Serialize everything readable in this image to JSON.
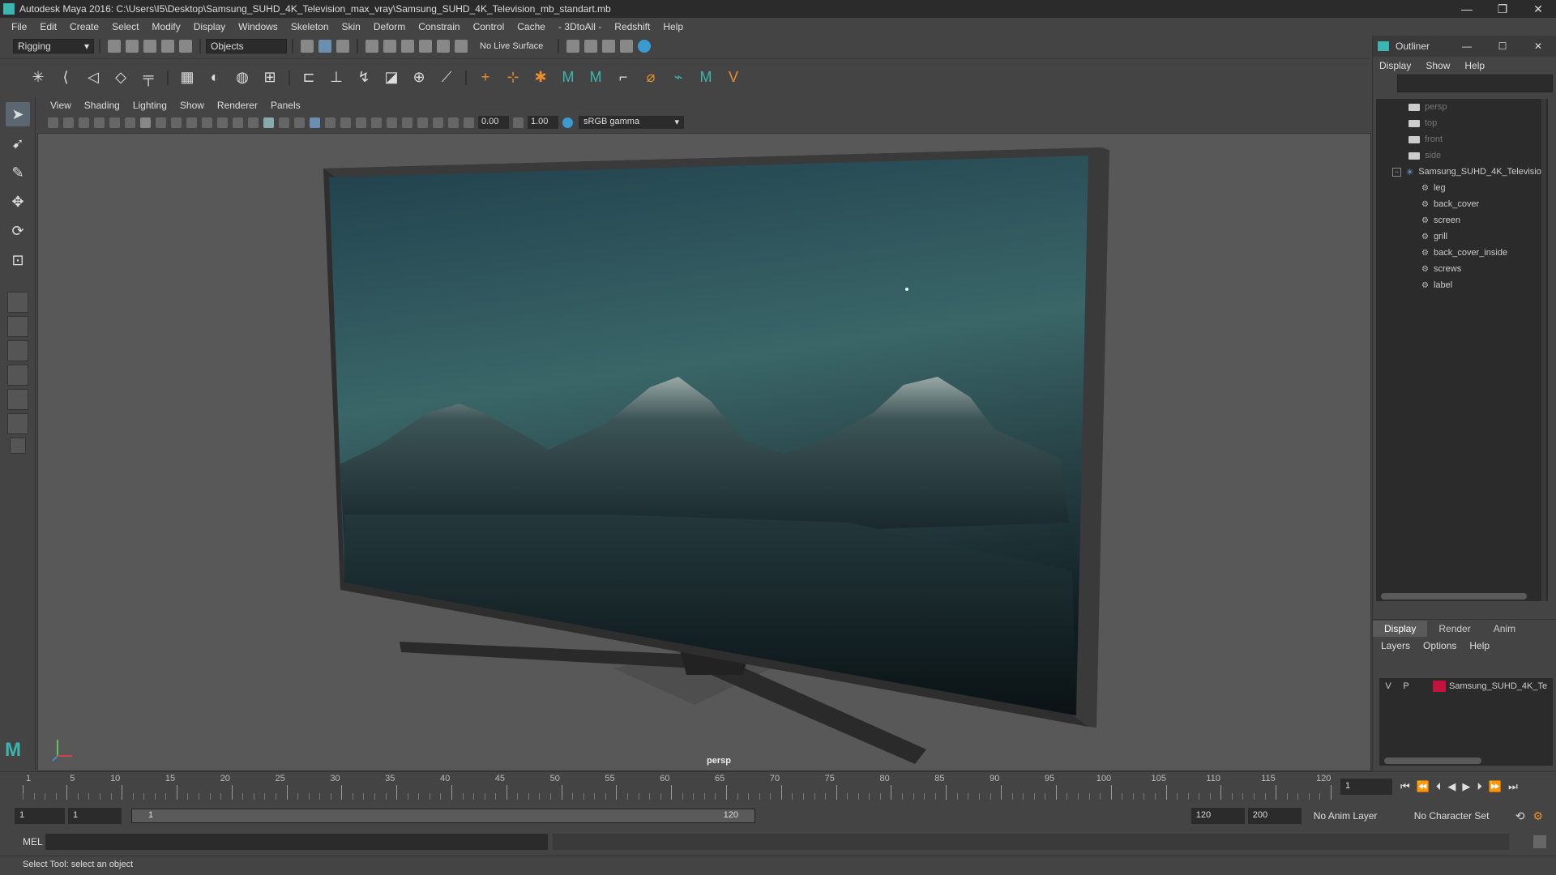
{
  "window": {
    "title": "Autodesk Maya 2016: C:\\Users\\I5\\Desktop\\Samsung_SUHD_4K_Television_max_vray\\Samsung_SUHD_4K_Television_mb_standart.mb",
    "minimize": "—",
    "restore": "❐",
    "close": "✕"
  },
  "menubar": [
    "File",
    "Edit",
    "Create",
    "Select",
    "Modify",
    "Display",
    "Windows",
    "Skeleton",
    "Skin",
    "Deform",
    "Constrain",
    "Control",
    "Cache",
    "- 3DtoAll -",
    "Redshift",
    "Help"
  ],
  "shelfbar": {
    "menuset": "Rigging",
    "selection_mode": "Objects",
    "live_surface": "No Live Surface"
  },
  "viewport_menu": [
    "View",
    "Shading",
    "Lighting",
    "Show",
    "Renderer",
    "Panels"
  ],
  "viewport_toolbar": {
    "exposure": "0.00",
    "gamma": "1.00",
    "colorspace": "sRGB gamma"
  },
  "viewport": {
    "camera_label": "persp",
    "screen_colors": {
      "sky_top": "#2b4c58",
      "sky_mid": "#3e6b6e",
      "mountain": "#1c2e32"
    }
  },
  "outliner": {
    "title": "Outliner",
    "menu": [
      "Display",
      "Show",
      "Help"
    ],
    "items": [
      {
        "label": "persp",
        "type": "camera",
        "dim": true
      },
      {
        "label": "top",
        "type": "camera",
        "dim": true
      },
      {
        "label": "front",
        "type": "camera",
        "dim": true
      },
      {
        "label": "side",
        "type": "camera",
        "dim": true
      },
      {
        "label": "Samsung_SUHD_4K_Televisio",
        "type": "group",
        "dim": false
      },
      {
        "label": "leg",
        "type": "mesh",
        "dim": false
      },
      {
        "label": "back_cover",
        "type": "mesh",
        "dim": false
      },
      {
        "label": "screen",
        "type": "mesh",
        "dim": false
      },
      {
        "label": "grill",
        "type": "mesh",
        "dim": false
      },
      {
        "label": "back_cover_inside",
        "type": "mesh",
        "dim": false
      },
      {
        "label": "screws",
        "type": "mesh",
        "dim": false
      },
      {
        "label": "label",
        "type": "mesh",
        "dim": false
      }
    ]
  },
  "layer_panel": {
    "tabs": [
      "Display",
      "Render",
      "Anim"
    ],
    "active_tab": "Display",
    "menu": [
      "Layers",
      "Options",
      "Help"
    ],
    "layers": [
      {
        "v": "V",
        "p": "P",
        "name": "Samsung_SUHD_4K_Te",
        "color": "#c0143c"
      }
    ]
  },
  "timeline": {
    "ticks": [
      1,
      5,
      10,
      15,
      20,
      25,
      30,
      35,
      40,
      45,
      50,
      55,
      60,
      65,
      70,
      75,
      80,
      85,
      90,
      95,
      100,
      105,
      110,
      115,
      120
    ],
    "current_frame": "1"
  },
  "range": {
    "start": "1",
    "playback_start": "1",
    "slider_start": "1",
    "slider_end": "120",
    "playback_end": "120",
    "end": "200",
    "anim_layer": "No Anim Layer",
    "character_set": "No Character Set"
  },
  "command_line": {
    "label": "MEL"
  },
  "help_line": "Select Tool: select an object"
}
